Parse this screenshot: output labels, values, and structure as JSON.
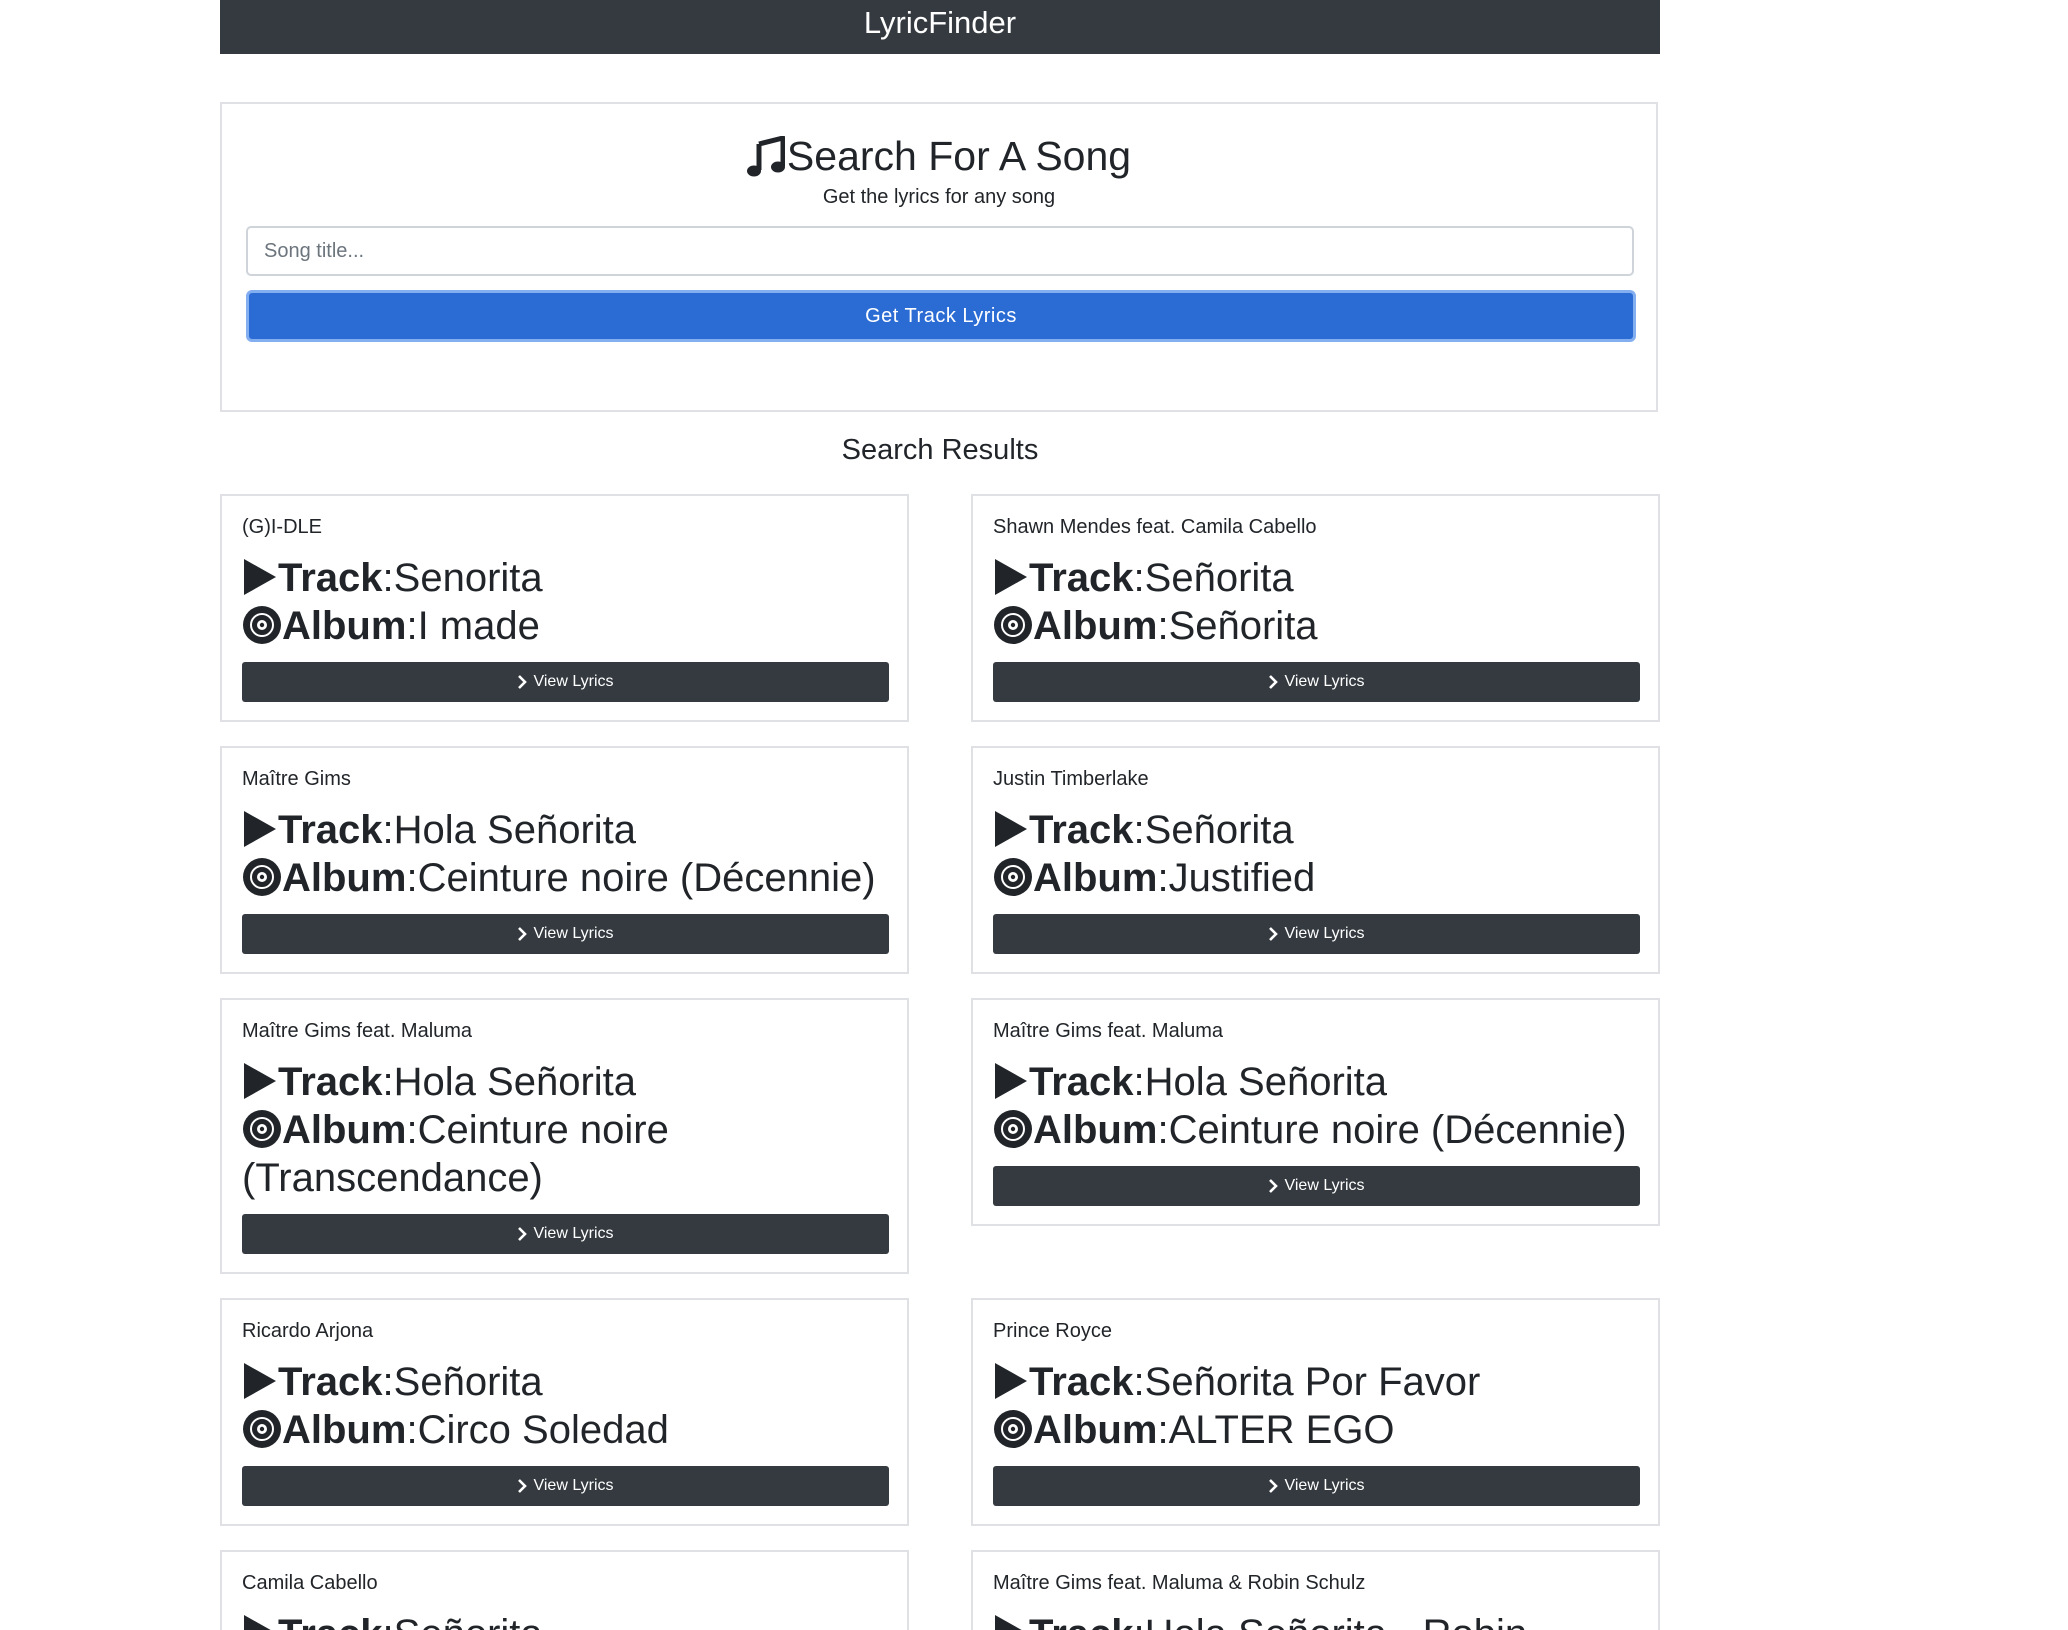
{
  "header": {
    "brand": "LyricFinder"
  },
  "search": {
    "title": "Search For A Song",
    "subtitle": "Get the lyrics for any song",
    "placeholder": "Song title...",
    "button_label": "Get Track Lyrics"
  },
  "results": {
    "heading": "Search Results",
    "track_label": "Track",
    "album_label": "Album",
    "view_label": "View Lyrics",
    "cards": [
      {
        "artist": "(G)I-DLE",
        "track": "Senorita",
        "album": "I made"
      },
      {
        "artist": "Shawn Mendes feat. Camila Cabello",
        "track": "Señorita",
        "album": "Señorita"
      },
      {
        "artist": "Maître Gims",
        "track": "Hola Señorita",
        "album": "Ceinture noire (Décennie)"
      },
      {
        "artist": "Justin Timberlake",
        "track": "Señorita",
        "album": "Justified"
      },
      {
        "artist": "Maître Gims feat. Maluma",
        "track": "Hola Señorita",
        "album": "Ceinture noire (Transcendance)"
      },
      {
        "artist": "Maître Gims feat. Maluma",
        "track": "Hola Señorita",
        "album": "Ceinture noire (Décennie)"
      },
      {
        "artist": "Ricardo Arjona",
        "track": "Señorita",
        "album": "Circo Soledad"
      },
      {
        "artist": "Prince Royce",
        "track": "Señorita Por Favor",
        "album": "ALTER EGO"
      },
      {
        "artist": "Camila Cabello",
        "track": "Señorita",
        "album": ""
      },
      {
        "artist": "Maître Gims feat. Maluma & Robin Schulz",
        "track": "Hola Señorita - Robin",
        "album": ""
      }
    ]
  }
}
